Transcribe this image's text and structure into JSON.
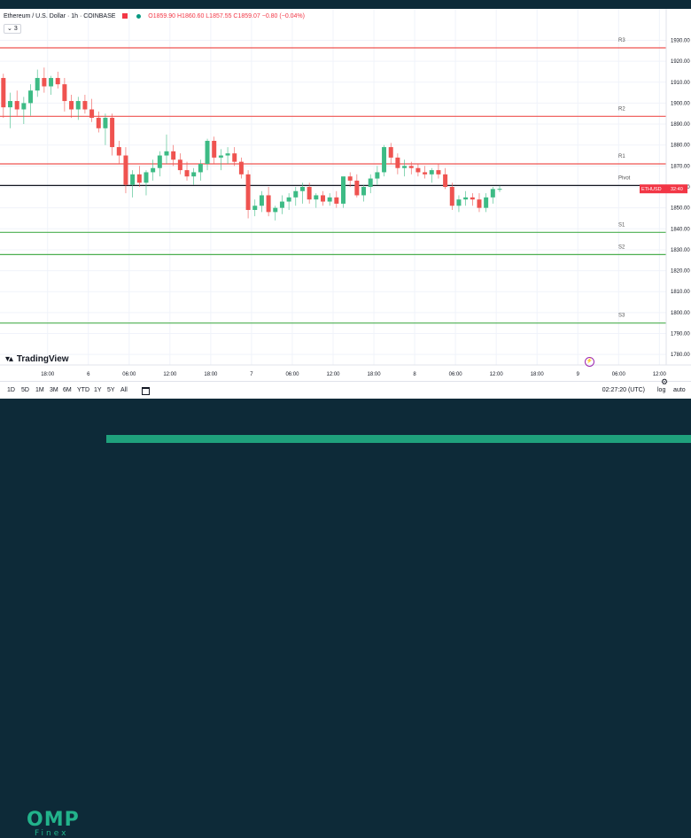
{
  "header": {
    "symbol": "Ethereum / U.S. Dollar · 1h · COINBASE",
    "ohlc": "O1859.90 H1860.60 L1857.55 C1859.07 −0.80 (−0.04%)",
    "indicator_count": "3"
  },
  "colors": {
    "up": "#26a69a",
    "up_body": "#3dbb85",
    "down": "#ef5350",
    "resistance": "#ef5350",
    "support": "#4caf50",
    "pivot": "#131722",
    "price_tag": "#f23645"
  },
  "chart_data": {
    "type": "candlestick",
    "title": "Ethereum / U.S. Dollar · 1h · COINBASE",
    "ylim": [
      1775,
      1945
    ],
    "y_ticks": [
      1780,
      1790,
      1800,
      1810,
      1820,
      1830,
      1840,
      1850,
      1860,
      1870,
      1880,
      1890,
      1900,
      1910,
      1920,
      1930
    ],
    "y_tick_labels": [
      "1780.00",
      "1790.00",
      "1800.00",
      "1810.00",
      "1820.00",
      "1830.00",
      "1840.00",
      "1850.00",
      "1860.00",
      "1870.00",
      "1880.00",
      "1890.00",
      "1900.00",
      "1910.00",
      "1920.00",
      "1930.00"
    ],
    "x_ticks": [
      {
        "label": "18:00",
        "i": 6.5
      },
      {
        "label": "6",
        "i": 12.5
      },
      {
        "label": "06:00",
        "i": 18.5
      },
      {
        "label": "12:00",
        "i": 24.5
      },
      {
        "label": "18:00",
        "i": 30.5
      },
      {
        "label": "7",
        "i": 36.5
      },
      {
        "label": "06:00",
        "i": 42.5
      },
      {
        "label": "12:00",
        "i": 48.5
      },
      {
        "label": "18:00",
        "i": 54.5
      },
      {
        "label": "8",
        "i": 60.5
      },
      {
        "label": "06:00",
        "i": 66.5
      },
      {
        "label": "12:00",
        "i": 72.5
      },
      {
        "label": "18:00",
        "i": 78.5
      },
      {
        "label": "9",
        "i": 84.5
      },
      {
        "label": "06:00",
        "i": 90.5
      },
      {
        "label": "12:00",
        "i": 96.5
      }
    ],
    "x_range": [
      -0.5,
      97.5
    ],
    "pivot_levels": [
      {
        "label": "R3",
        "value": 1926.4
      },
      {
        "label": "R2",
        "value": 1893.7
      },
      {
        "label": "R1",
        "value": 1871.0
      },
      {
        "label": "Pivot",
        "value": 1860.7
      },
      {
        "label": "S1",
        "value": 1838.3
      },
      {
        "label": "S2",
        "value": 1827.7
      },
      {
        "label": "S3",
        "value": 1795.0
      }
    ],
    "current_price": {
      "label": "ETHUSD",
      "value": "32:40",
      "price": 1859.07
    },
    "candles": [
      [
        1912,
        1914,
        1893,
        1898
      ],
      [
        1898,
        1905,
        1888,
        1901
      ],
      [
        1901,
        1906,
        1894,
        1897
      ],
      [
        1897,
        1903,
        1890,
        1900
      ],
      [
        1900,
        1909,
        1894,
        1906
      ],
      [
        1906,
        1916,
        1903,
        1912
      ],
      [
        1912,
        1917,
        1905,
        1908
      ],
      [
        1908,
        1913,
        1904,
        1912
      ],
      [
        1912,
        1915,
        1907,
        1909
      ],
      [
        1909,
        1912,
        1896,
        1901
      ],
      [
        1901,
        1904,
        1893,
        1897
      ],
      [
        1897,
        1903,
        1892,
        1901
      ],
      [
        1901,
        1904,
        1895,
        1897
      ],
      [
        1897,
        1902,
        1891,
        1893
      ],
      [
        1893,
        1896,
        1886,
        1888
      ],
      [
        1888,
        1895,
        1880,
        1893
      ],
      [
        1893,
        1895,
        1875,
        1879
      ],
      [
        1879,
        1882,
        1871,
        1875
      ],
      [
        1875,
        1879,
        1857,
        1861
      ],
      [
        1861,
        1868,
        1855,
        1866
      ],
      [
        1866,
        1870,
        1860,
        1862
      ],
      [
        1862,
        1868,
        1856,
        1867
      ],
      [
        1867,
        1873,
        1863,
        1869
      ],
      [
        1869,
        1877,
        1865,
        1875
      ],
      [
        1875,
        1885,
        1871,
        1877
      ],
      [
        1877,
        1880,
        1870,
        1873
      ],
      [
        1873,
        1876,
        1866,
        1868
      ],
      [
        1868,
        1872,
        1863,
        1865
      ],
      [
        1865,
        1869,
        1861,
        1867
      ],
      [
        1867,
        1873,
        1863,
        1871
      ],
      [
        1871,
        1883,
        1868,
        1882
      ],
      [
        1882,
        1884,
        1871,
        1874
      ],
      [
        1874,
        1878,
        1868,
        1875
      ],
      [
        1875,
        1879,
        1871,
        1876
      ],
      [
        1876,
        1879,
        1870,
        1872
      ],
      [
        1872,
        1874,
        1864,
        1866
      ],
      [
        1866,
        1868,
        1845,
        1849
      ],
      [
        1849,
        1854,
        1846,
        1851
      ],
      [
        1851,
        1858,
        1848,
        1856
      ],
      [
        1856,
        1860,
        1846,
        1848
      ],
      [
        1848,
        1851,
        1844,
        1850
      ],
      [
        1850,
        1856,
        1847,
        1853
      ],
      [
        1853,
        1857,
        1849,
        1855
      ],
      [
        1855,
        1860,
        1851,
        1858
      ],
      [
        1858,
        1862,
        1852,
        1860
      ],
      [
        1860,
        1862,
        1852,
        1854
      ],
      [
        1854,
        1857,
        1850,
        1856
      ],
      [
        1856,
        1858,
        1851,
        1853
      ],
      [
        1853,
        1857,
        1851,
        1855
      ],
      [
        1855,
        1858,
        1850,
        1852
      ],
      [
        1852,
        1862,
        1850,
        1865
      ],
      [
        1865,
        1867,
        1860,
        1863
      ],
      [
        1863,
        1866,
        1855,
        1856
      ],
      [
        1856,
        1861,
        1853,
        1860
      ],
      [
        1860,
        1866,
        1857,
        1864
      ],
      [
        1864,
        1870,
        1861,
        1867
      ],
      [
        1867,
        1880,
        1865,
        1879
      ],
      [
        1879,
        1881,
        1871,
        1874
      ],
      [
        1874,
        1876,
        1866,
        1869
      ],
      [
        1869,
        1873,
        1865,
        1870
      ],
      [
        1870,
        1872,
        1866,
        1869
      ],
      [
        1869,
        1871,
        1865,
        1867
      ],
      [
        1867,
        1870,
        1864,
        1866
      ],
      [
        1866,
        1869,
        1862,
        1868
      ],
      [
        1868,
        1871,
        1864,
        1866
      ],
      [
        1866,
        1869,
        1859,
        1860
      ],
      [
        1860,
        1862,
        1849,
        1851
      ],
      [
        1851,
        1856,
        1848,
        1854
      ],
      [
        1854,
        1858,
        1851,
        1855
      ],
      [
        1855,
        1857,
        1851,
        1854
      ],
      [
        1854,
        1857,
        1848,
        1850
      ],
      [
        1850,
        1857,
        1848,
        1855
      ],
      [
        1855,
        1860,
        1852,
        1859
      ],
      [
        1859,
        1860.6,
        1857.55,
        1859.07
      ]
    ]
  },
  "bottombar": {
    "timeframes": [
      "1D",
      "5D",
      "1M",
      "3M",
      "6M",
      "YTD",
      "1Y",
      "5Y",
      "All"
    ],
    "clock": "02:27:20 (UTC)",
    "log": "log",
    "auto": "auto"
  },
  "branding": {
    "tradingview": "TradingView",
    "omp": "OMP",
    "finex": "Finex"
  }
}
